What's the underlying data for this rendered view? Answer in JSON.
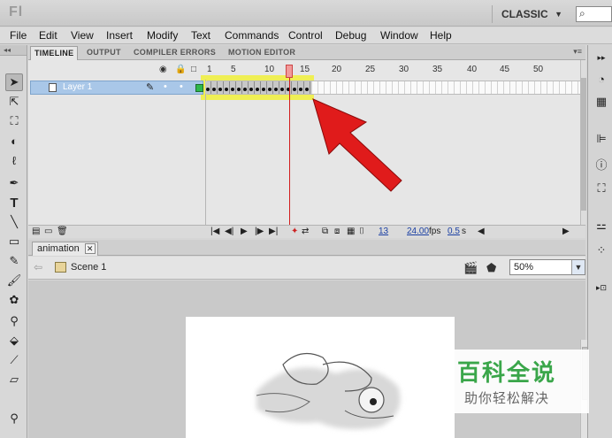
{
  "titlebar": {
    "app_logo": "Fl",
    "workspace": "CLASSIC",
    "workspace_caret": "▼",
    "search_glyph": "⌕"
  },
  "menu": [
    "File",
    "Edit",
    "View",
    "Insert",
    "Modify",
    "Text",
    "Commands",
    "Control",
    "Debug",
    "Window",
    "Help"
  ],
  "toolbox": {
    "grip": "◂◂",
    "tools": [
      "selection-tool",
      "subselection-tool",
      "free-transform-tool",
      "3d-rotation-tool",
      "lasso-tool",
      "pen-tool",
      "text-tool",
      "line-tool",
      "rectangle-tool",
      "pencil-tool",
      "brush-tool",
      "deco-tool",
      "bone-tool",
      "paint-bucket-tool",
      "eyedropper-tool",
      "eraser-tool",
      "zoom-tool"
    ]
  },
  "timeline": {
    "tabs": [
      "TIMELINE",
      "OUTPUT",
      "COMPILER ERRORS",
      "MOTION EDITOR"
    ],
    "panel_menu": "▾≡",
    "ruler": [
      "1",
      "5",
      "10",
      "15",
      "20",
      "25",
      "30",
      "35",
      "40",
      "45",
      "50"
    ],
    "layer_name": "Layer 1",
    "filled_frame_count": 17,
    "current_frame": "13",
    "frame_rate": "24.00",
    "fps_label": "fps",
    "elapsed_time": "0.5",
    "time_unit": "s"
  },
  "document": {
    "tab_name": "animation",
    "tab_close": "✕",
    "scene_label": "Scene 1",
    "zoom": "50%"
  },
  "watermark": {
    "title": "百科全说",
    "subtitle": "助你轻松解决"
  }
}
